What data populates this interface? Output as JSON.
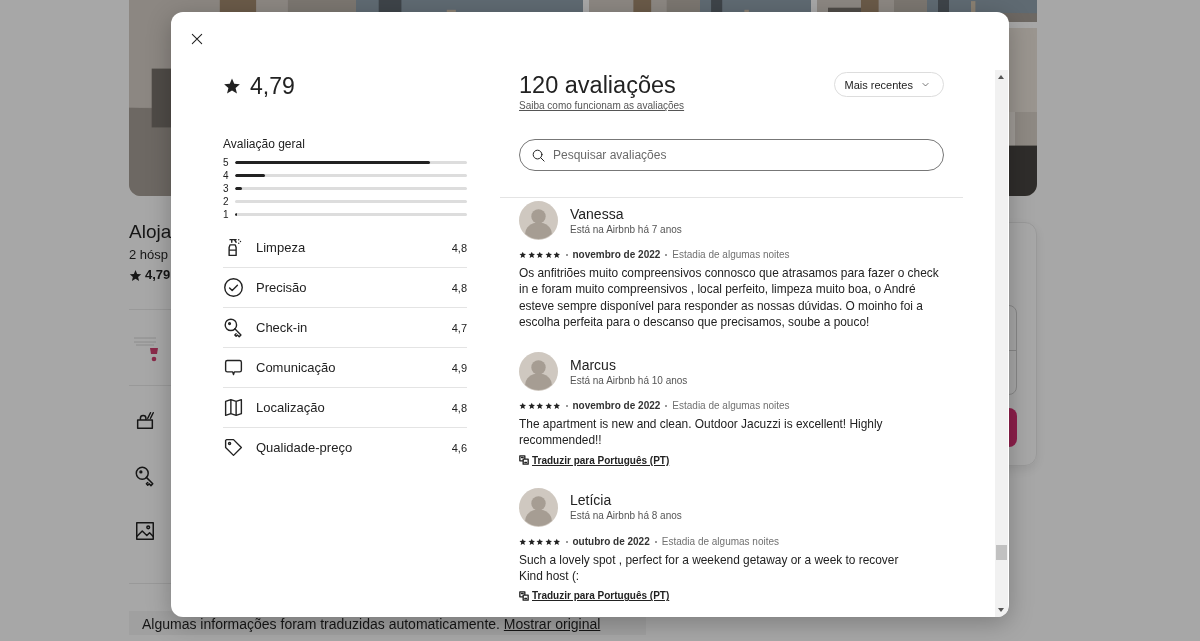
{
  "listing_page": {
    "title": "Aloja",
    "subtitle": "2 hósp",
    "rating": "4,79",
    "translation_notice": {
      "text": "Algumas informações foram traduzidas automaticamente.",
      "link": "Mostrar original"
    }
  },
  "reviews_dialog": {
    "rating": "4,79",
    "overall": {
      "title": "Avaliação geral",
      "bars": [
        {
          "label": "5",
          "level": 0.84
        },
        {
          "label": "4",
          "level": 0.13
        },
        {
          "label": "3",
          "level": 0.03
        },
        {
          "label": "2"
        },
        {
          "label": "1",
          "level": 0.01
        }
      ]
    },
    "categories": [
      {
        "kind": "cleanliness",
        "label": "Limpeza",
        "value": "4,8"
      },
      {
        "kind": "accuracy",
        "label": "Precisão",
        "value": "4,8"
      },
      {
        "kind": "checkin",
        "label": "Check-in",
        "value": "4,7"
      },
      {
        "kind": "communication",
        "label": "Comunicação",
        "value": "4,9"
      },
      {
        "kind": "location",
        "label": "Localização",
        "value": "4,8"
      },
      {
        "kind": "value",
        "label": "Qualidade-preço",
        "value": "4,6"
      }
    ],
    "count_title": "120 avaliações",
    "help_link": "Saiba como funcionam as avaliações",
    "sort": {
      "label": "Mais recentes"
    },
    "search": {
      "placeholder": "Pesquisar avaliações"
    },
    "reviews": [
      {
        "name": "Vanessa",
        "member_since": "Está na Airbnb há 7 anos",
        "stars": 5,
        "date": "novembro de 2022",
        "stay": "Estadia de algumas noites",
        "text": "Os anfitriões muito compreensivos connosco que atrasamos para fazer o check in e foram muito compreensivos , local perfeito, limpeza muito boa, o André esteve sempre disponível para responder as nossas dúvidas. O moinho foi a escolha perfeita para o descanso que precisamos, soube a pouco!"
      },
      {
        "name": "Marcus",
        "member_since": "Está na Airbnb há 10 anos",
        "stars": 5,
        "date": "novembro de 2022",
        "stay": "Estadia de algumas noites",
        "text": "The apartment is new and clean. Outdoor Jacuzzi is excellent! Highly recommended!!",
        "translate_link": "Traduzir para Português (PT)"
      },
      {
        "name": "Letícia",
        "member_since": "Está na Airbnb há 8 anos",
        "stars": 5,
        "date": "outubro de 2022",
        "stay": "Estadia de algumas noites",
        "text": "Such a lovely spot , perfect for a weekend getaway or a week to recover\nKind host (:",
        "translate_link": "Traduzir para Português (PT)"
      }
    ]
  }
}
